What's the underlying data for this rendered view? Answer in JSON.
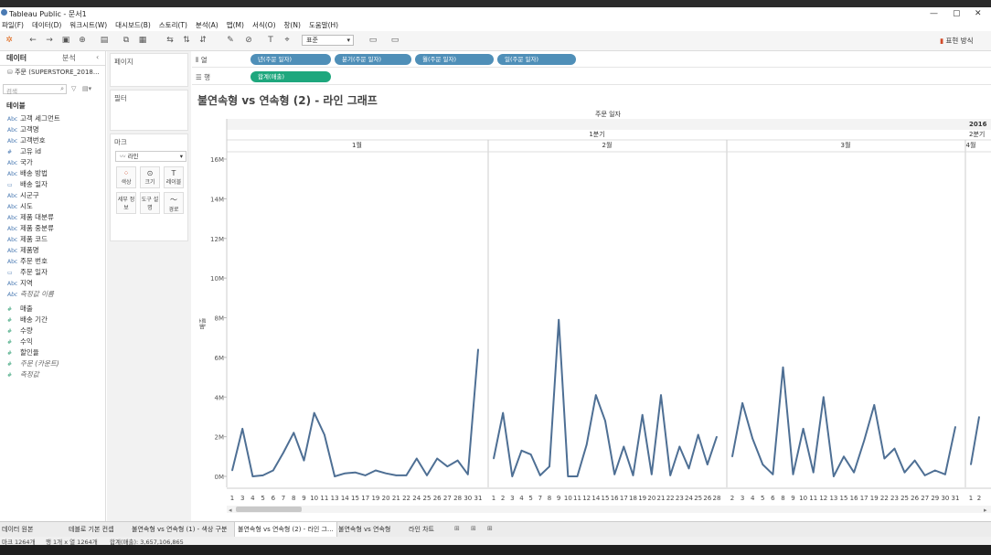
{
  "app": {
    "title": "Tableau Public - 문서1"
  },
  "menu": [
    "파일(F)",
    "데이터(D)",
    "워크시트(W)",
    "대시보드(B)",
    "스토리(T)",
    "분석(A)",
    "맵(M)",
    "서식(O)",
    "창(N)",
    "도움말(H)"
  ],
  "toolbar": {
    "font_select": "표준",
    "show_me": "표현 방식"
  },
  "data_pane": {
    "tab_data": "데이터",
    "tab_analysis": "분석",
    "source": "주문 (SUPERSTORE_2018...",
    "search_placeholder": "검색",
    "tables_header": "테이블",
    "dimensions": [
      [
        "Abc",
        "고객 세그먼트"
      ],
      [
        "Abc",
        "고객명"
      ],
      [
        "Abc",
        "고객번호"
      ],
      [
        "#",
        "고유 id"
      ],
      [
        "Abc",
        "국가"
      ],
      [
        "Abc",
        "배송 방법"
      ],
      [
        "▭",
        "배송 일자"
      ],
      [
        "Abc",
        "시군구"
      ],
      [
        "Abc",
        "시도"
      ],
      [
        "Abc",
        "제품 대분류"
      ],
      [
        "Abc",
        "제품 중분류"
      ],
      [
        "Abc",
        "제품 코드"
      ],
      [
        "Abc",
        "제품명"
      ],
      [
        "Abc",
        "주문 번호"
      ],
      [
        "▭",
        "주문 일자"
      ],
      [
        "Abc",
        "지역"
      ],
      [
        "Abc",
        "측정값 이름"
      ]
    ],
    "measures": [
      [
        "#",
        "매출"
      ],
      [
        "#",
        "배송 기간"
      ],
      [
        "#",
        "수량"
      ],
      [
        "#",
        "수익"
      ],
      [
        "#",
        "할인율"
      ],
      [
        "#",
        "주문 (카운트)"
      ],
      [
        "#",
        "측정값"
      ]
    ]
  },
  "cards": {
    "pages": "페이지",
    "filters": "필터",
    "marks": "마크",
    "mark_type": "라인",
    "mark_buttons": [
      "색상",
      "크기",
      "레이블",
      "세부 정보",
      "도구 설명",
      "경로"
    ]
  },
  "shelves": {
    "columns_label": "열",
    "rows_label": "행",
    "columns": [
      "년(주문 일자)",
      "분기(주문 일자)",
      "월(주문 일자)",
      "일(주문 일자)"
    ],
    "rows": [
      "합계(매출)"
    ]
  },
  "viz": {
    "title": "불연속형 vs 연속형 (2) - 라인 그래프",
    "header_field": "주문 일자",
    "year_label": "2016",
    "quarter_label": "1분기",
    "quarter_label_next": "2분기",
    "months": [
      "1월",
      "2월",
      "3월",
      "4월"
    ],
    "ylabel": "매출"
  },
  "chart_data": {
    "type": "line",
    "ylabel": "매출",
    "yticks": [
      "0M",
      "2M",
      "4M",
      "6M",
      "8M",
      "10M",
      "12M",
      "14M",
      "16M"
    ],
    "ylim": [
      0,
      17
    ],
    "panels": [
      {
        "month": "1월",
        "days": [
          1,
          3,
          4,
          5,
          6,
          7,
          8,
          9,
          10,
          11,
          13,
          14,
          15,
          17,
          19,
          20,
          21,
          22,
          24,
          25,
          26,
          27,
          28,
          30,
          31
        ],
        "values": [
          0.3,
          2.4,
          0.0,
          0.05,
          0.3,
          1.2,
          2.2,
          0.8,
          3.2,
          2.1,
          0.0,
          0.15,
          0.2,
          0.05,
          0.3,
          0.15,
          0.05,
          0.05,
          0.9,
          0.05,
          0.9,
          0.5,
          0.8,
          0.1,
          6.4
        ]
      },
      {
        "month": "2월",
        "days": [
          1,
          2,
          3,
          4,
          5,
          7,
          8,
          9,
          10,
          11,
          12,
          14,
          15,
          16,
          17,
          18,
          19,
          20,
          21,
          22,
          23,
          24,
          25,
          26,
          28
        ],
        "values": [
          0.9,
          3.2,
          0.0,
          1.3,
          1.1,
          0.05,
          0.5,
          7.9,
          0.0,
          0.0,
          1.6,
          4.1,
          2.8,
          0.1,
          1.5,
          0.05,
          3.1,
          0.1,
          4.1,
          0.05,
          1.5,
          0.4,
          2.1,
          0.6,
          2.0
        ]
      },
      {
        "month": "3월",
        "days": [
          2,
          3,
          4,
          5,
          6,
          8,
          9,
          10,
          11,
          12,
          13,
          15,
          16,
          17,
          19,
          22,
          23,
          25,
          26,
          27,
          29,
          30,
          31
        ],
        "values": [
          1.0,
          3.7,
          1.9,
          0.6,
          0.1,
          5.5,
          0.1,
          2.4,
          0.2,
          4.0,
          0.0,
          1.0,
          0.2,
          1.8,
          3.6,
          0.9,
          1.4,
          0.2,
          0.8,
          0.05,
          0.3,
          0.1,
          2.5
        ]
      },
      {
        "month": "4월",
        "days": [
          1,
          2
        ],
        "values": [
          0.6,
          3.0
        ]
      }
    ]
  },
  "sheet_tabs": [
    "데이터 원본",
    "테블로 기본 컨셉",
    "불연속형 vs 연속형 (1) - 색상 구분",
    "불연속형 vs 연속형 (2) - 라인 그...",
    "불연속형 vs 연속형",
    "라인 차트"
  ],
  "status": {
    "marks": "마크 1264개",
    "rows": "행 1개 x 열 1264개",
    "sum": "합계(매출): 3,657,106,865"
  }
}
